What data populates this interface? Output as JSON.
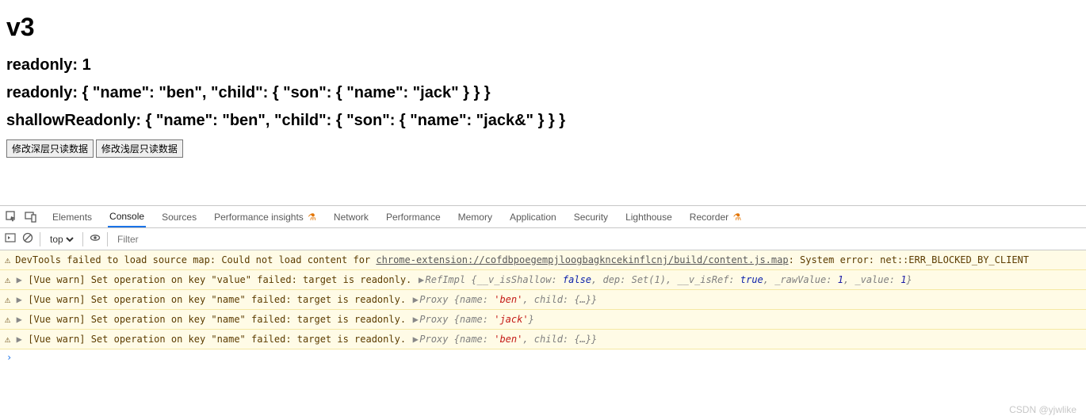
{
  "page": {
    "title": "v3",
    "lines": [
      "readonly: 1",
      "readonly: { \"name\": \"ben\", \"child\": { \"son\": { \"name\": \"jack\" } } }",
      "shallowReadonly: { \"name\": \"ben\", \"child\": { \"son\": { \"name\": \"jack&\" } } }"
    ],
    "buttons": [
      "修改深层只读数据",
      "修改浅层只读数据"
    ]
  },
  "devtools": {
    "tabs": [
      "Elements",
      "Console",
      "Sources",
      "Performance insights",
      "Network",
      "Performance",
      "Memory",
      "Application",
      "Security",
      "Lighthouse",
      "Recorder"
    ],
    "active_tab": "Console",
    "context": "top",
    "filter_placeholder": "Filter",
    "logs": {
      "sourcemap_prefix": "DevTools failed to load source map: Could not load content for ",
      "sourcemap_link": "chrome-extension://cofdbpoegempjloogbagkncekinflcnj/build/content.js.map",
      "sourcemap_suffix": ": System error: net::ERR_BLOCKED_BY_CLIENT",
      "warn_value": "[Vue warn] Set operation on key \"value\" failed: target is readonly. ",
      "warn_name": "[Vue warn] Set operation on key \"name\" failed: target is readonly. ",
      "refimpl_label": "RefImpl ",
      "refimpl_body": "{__v_isShallow: ",
      "refimpl_dep": ", dep: Set(1), __v_isRef: ",
      "refimpl_raw": ", _rawValue: ",
      "refimpl_val": ", _value: ",
      "refimpl_close": "}",
      "proxy_label": "Proxy ",
      "proxy_benchild": "{name: ",
      "proxy_ben": "'ben'",
      "proxy_child": ", child: {…}}",
      "proxy_jack": "'jack'",
      "proxy_jack_close": "}"
    },
    "watermark": "CSDN @yjwlike"
  }
}
